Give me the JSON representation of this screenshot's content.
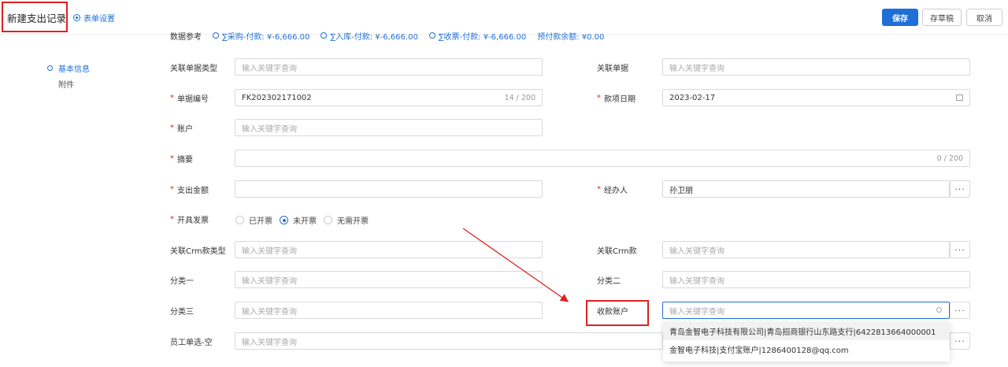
{
  "header": {
    "title": "新建支出记录",
    "settings_label": "表单设置",
    "save_label": "保存",
    "draft_label": "存草稿",
    "cancel_label": "取消"
  },
  "side_nav": {
    "items": [
      {
        "label": "基本信息"
      },
      {
        "label": "附件"
      }
    ]
  },
  "reference": {
    "label": "数据参考",
    "items": [
      "∑采购-付款: ¥-6,666.00",
      "∑入库-付款: ¥-6,666.00",
      "∑收票-付款: ¥-6,666.00"
    ],
    "balance": "预付款余额: ¥0.00"
  },
  "form": {
    "placeholder": "输入关键字查询",
    "related_doc_type": {
      "label": "关联单据类型"
    },
    "related_doc": {
      "label": "关联单据"
    },
    "doc_no": {
      "label": "单据编号",
      "value": "FK202302171002",
      "counter": "14 / 200"
    },
    "payment_date": {
      "label": "款项日期",
      "value": "2023-02-17"
    },
    "account": {
      "label": "账户"
    },
    "summary": {
      "label": "摘要",
      "counter": "0 / 200"
    },
    "amount": {
      "label": "支出金额"
    },
    "handler": {
      "label": "经办人",
      "value": "孙卫朋"
    },
    "invoice": {
      "label": "开具发票",
      "options": [
        "已开票",
        "未开票",
        "无需开票"
      ],
      "selected": "未开票"
    },
    "crm_type": {
      "label": "关联Crm款类型"
    },
    "crm": {
      "label": "关联Crm款"
    },
    "cat1": {
      "label": "分类一"
    },
    "cat2": {
      "label": "分类二"
    },
    "cat3": {
      "label": "分类三"
    },
    "receiving_account": {
      "label": "收款账户"
    },
    "employee": {
      "label": "员工单选-空"
    },
    "more_label": "···"
  },
  "dropdown": {
    "options": [
      "青岛金智电子科技有限公司|青岛招商银行山东路支行|6422813664000001",
      "金智电子科技|支付宝账户|1286400128@qq.com"
    ]
  },
  "colors": {
    "primary": "#1f6fd6",
    "highlight": "#e02020"
  }
}
